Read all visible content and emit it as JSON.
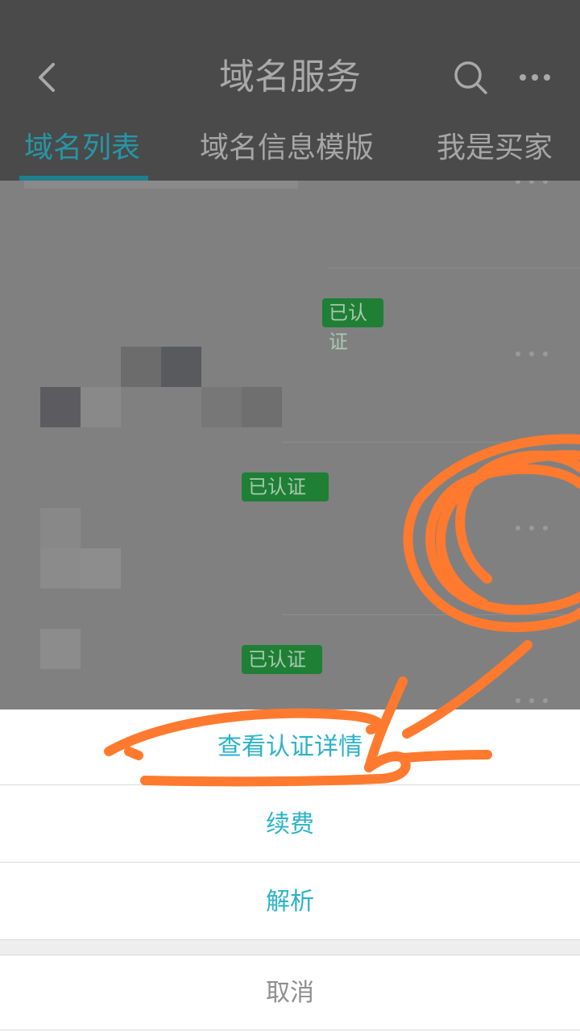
{
  "header": {
    "title": "域名服务",
    "back_icon": "chevron-left-icon",
    "search_icon": "search-icon",
    "more_icon": "more-horizontal-icon"
  },
  "tabs": [
    {
      "label": "域名列表",
      "active": true
    },
    {
      "label": "域名信息模版",
      "active": false
    },
    {
      "label": "我是买家",
      "active": false
    }
  ],
  "list": {
    "rows": [
      {
        "badge": ""
      },
      {
        "badge": "已认证"
      },
      {
        "badge": "已认证"
      },
      {
        "badge": "已认证"
      }
    ]
  },
  "action_sheet": {
    "items": [
      {
        "label": "查看认证详情"
      },
      {
        "label": "续费"
      },
      {
        "label": "解析"
      }
    ],
    "cancel_label": "取消"
  },
  "colors": {
    "accent": "#2ab3c9",
    "annotation": "#ff7a2e",
    "badge_green": "#1e7f35"
  }
}
